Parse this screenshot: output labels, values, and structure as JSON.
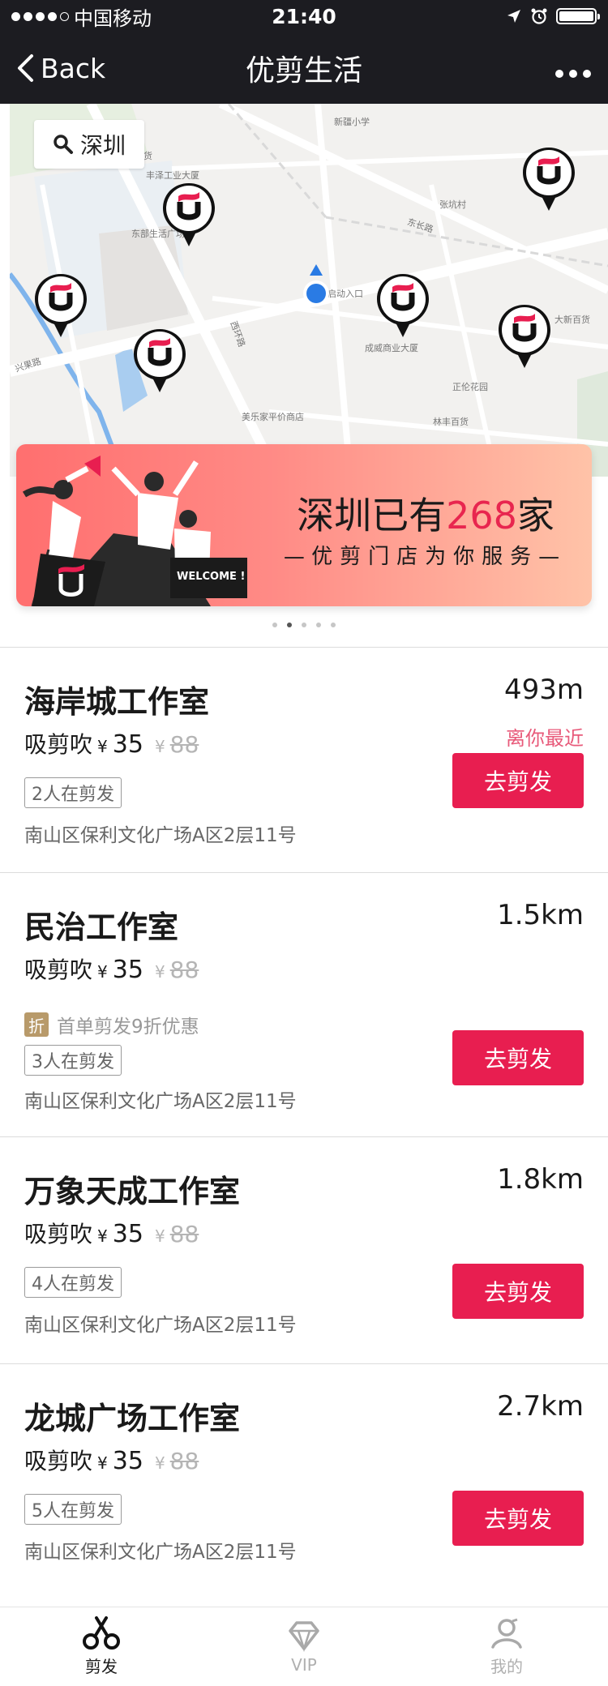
{
  "status_bar": {
    "carrier": "中国移动",
    "time": "21:40"
  },
  "nav": {
    "back_label": "Back",
    "title": "优剪生活"
  },
  "map": {
    "city": "深圳",
    "labels": [
      "新疆小学",
      "顺丰百货",
      "丰泽工业大厦",
      "东部生活广场",
      "张坑村",
      "东长路",
      "西环路",
      "启动入口",
      "成威商业大厦",
      "大新百货",
      "正伦花园",
      "林丰百货",
      "美乐家平价商店",
      "兴果路"
    ]
  },
  "banner": {
    "headline_prefix": "深圳已有",
    "headline_number": "268",
    "headline_suffix": "家",
    "subtitle": "优剪门店为你服务",
    "welcome": "WELCOME !",
    "page_count": 5,
    "active_page": 2
  },
  "stores": [
    {
      "name": "海岸城工作室",
      "distance": "493m",
      "nearest_tag": "离你最近",
      "service": "吸剪吹",
      "currency": "¥",
      "price": "35",
      "original_price": "88",
      "queue": "2人在剪发",
      "address": "南山区保利文化广场A区2层11号",
      "button": "去剪发"
    },
    {
      "name": "民治工作室",
      "distance": "1.5km",
      "service": "吸剪吹",
      "currency": "¥",
      "price": "35",
      "original_price": "88",
      "promo_tag": "折",
      "promo_text": "首单剪发9折优惠",
      "queue": "3人在剪发",
      "address": "南山区保利文化广场A区2层11号",
      "button": "去剪发"
    },
    {
      "name": "万象天成工作室",
      "distance": "1.8km",
      "service": "吸剪吹",
      "currency": "¥",
      "price": "35",
      "original_price": "88",
      "queue": "4人在剪发",
      "address": "南山区保利文化广场A区2层11号",
      "button": "去剪发"
    },
    {
      "name": "龙城广场工作室",
      "distance": "2.7km",
      "service": "吸剪吹",
      "currency": "¥",
      "price": "35",
      "original_price": "88",
      "queue": "5人在剪发",
      "address": "南山区保利文化广场A区2层11号",
      "button": "去剪发"
    }
  ],
  "tabbar": {
    "tabs": [
      {
        "label": "剪发",
        "icon": "scissors-icon",
        "active": true
      },
      {
        "label": "VIP",
        "icon": "diamond-icon",
        "active": false
      },
      {
        "label": "我的",
        "icon": "user-icon",
        "active": false
      }
    ]
  },
  "colors": {
    "nav_background": "#1c1c21",
    "accent": "#e81e50",
    "nearest_text": "#e85a7a",
    "banner_number": "#e8264f",
    "promo_tag": "#b89a6a"
  }
}
